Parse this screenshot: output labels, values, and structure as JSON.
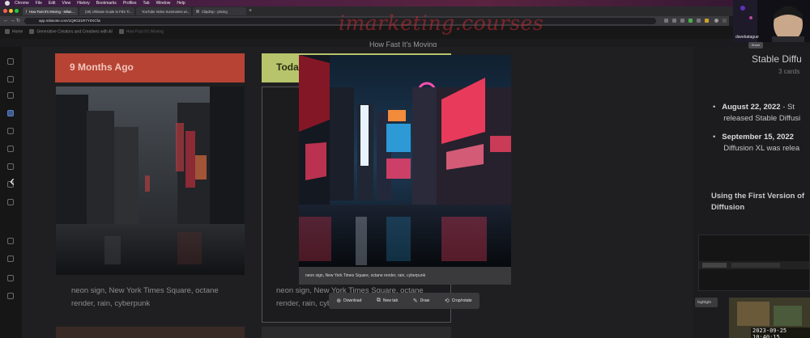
{
  "menubar": {
    "items": [
      "Chrome",
      "File",
      "Edit",
      "View",
      "History",
      "Bookmarks",
      "Profiles",
      "Tab",
      "Window",
      "Help"
    ]
  },
  "browser": {
    "tabs": [
      {
        "label": "How Fast It's Moving - Milan..."
      },
      {
        "label": "(26) Ultimate Guide to Film Ti..."
      },
      {
        "label": "YouTube Video Summaries wi..."
      },
      {
        "label": "Clipdrop - pricing"
      }
    ],
    "url": "app.milanote.com/1Q9GZ1R7Y0XCfw"
  },
  "app": {
    "breadcrumbs": [
      "Home",
      "Generative Creators and Creatives with AI",
      "How Fast It's Moving"
    ],
    "watermark": "imarketing.courses",
    "board_title": "How Fast It's Moving"
  },
  "columns": [
    {
      "header": "9 Months Ago",
      "caption": "neon sign, New York Times Square, octane render, rain, cyberpunk",
      "color": "#c44a3b"
    },
    {
      "header": "Today",
      "caption": "neon sign, New York Times Square, octane render, rain, cyberpunk",
      "color": "#b7c46b"
    }
  ],
  "modal": {
    "caption": "neon sign, New York Times Square, octane render, rain, cyberpunk",
    "toolbar": [
      {
        "label": "Download",
        "icon": "download-icon"
      },
      {
        "label": "New tab",
        "icon": "external-link-icon"
      },
      {
        "label": "Draw",
        "icon": "pencil-icon"
      },
      {
        "label": "Crop/rotate",
        "icon": "crop-icon"
      }
    ]
  },
  "right_panel": {
    "title": "Stable Diffu",
    "count": "3 cards",
    "bullets": [
      {
        "date": "August 22, 2022",
        "rest": " - St",
        "line2": "released Stable Diffusi"
      },
      {
        "date": "September 15, 2022",
        "rest": "",
        "line2": "Diffusion XL was relea"
      }
    ],
    "heading_line1": "Using the First Version of",
    "heading_line2": "Diffusion",
    "tag": "highlight"
  },
  "webcam": {
    "label": "davekatague",
    "share": "Share"
  },
  "timestamp": "2023-09-25  10:40:15",
  "colors": {
    "accent_red": "#c62a32",
    "board_bg": "#1f1f21"
  }
}
